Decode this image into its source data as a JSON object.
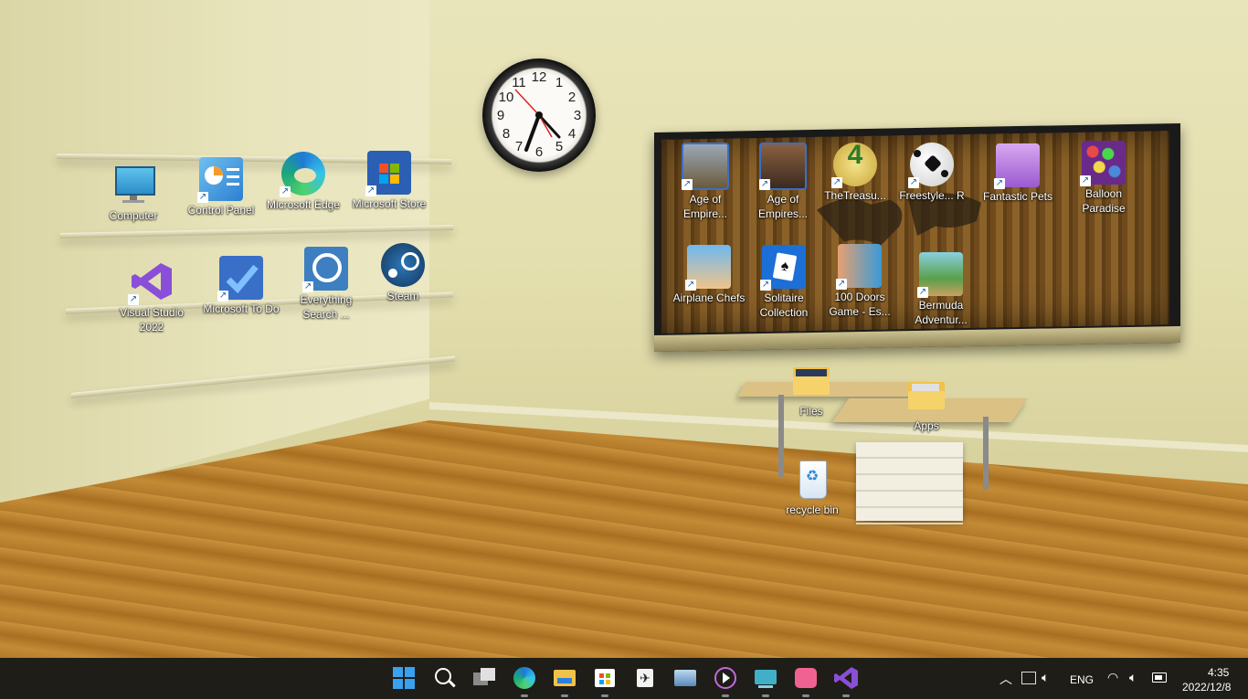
{
  "desktop": {
    "clock_numbers": [
      "12",
      "1",
      "2",
      "3",
      "4",
      "5",
      "6",
      "7",
      "8",
      "9",
      "10",
      "11"
    ],
    "icons": [
      {
        "label": "Computer",
        "icon": "monitor-icon",
        "color": "#3fa6d8",
        "shortcut": false
      },
      {
        "label": "Control Panel",
        "icon": "control-panel-icon",
        "color": "#4a9be0",
        "shortcut": true
      },
      {
        "label": "Microsoft Edge",
        "icon": "edge-icon",
        "color": "#1ba67b",
        "shortcut": true
      },
      {
        "label": "Microsoft Store",
        "icon": "store-icon",
        "color": "#2b5fb3",
        "shortcut": true
      },
      {
        "label": "Visual Studio 2022",
        "icon": "visual-studio-icon",
        "color": "#8a4fd8",
        "shortcut": true
      },
      {
        "label": "Microsoft To Do",
        "icon": "todo-icon",
        "color": "#2f6fd8",
        "shortcut": true
      },
      {
        "label": "Everything Search ...",
        "icon": "everything-search-icon",
        "color": "#3d7fc0",
        "shortcut": true
      },
      {
        "label": "Steam",
        "icon": "steam-icon",
        "color": "#16345a",
        "shortcut": false
      },
      {
        "label": "Age of Empire...",
        "icon": "age-of-empires-icon",
        "color": "#6b5a3a",
        "shortcut": true
      },
      {
        "label": "Age of Empires...",
        "icon": "age-of-empires-2-icon",
        "color": "#5a4030",
        "shortcut": true
      },
      {
        "label": "TheTreasu...",
        "icon": "treasure-icon",
        "color": "#c9a53a",
        "shortcut": true
      },
      {
        "label": "Freestyle... R",
        "icon": "soccer-ball-icon",
        "color": "#f2f2f2",
        "shortcut": true
      },
      {
        "label": "Fantastic Pets",
        "icon": "pet-icon",
        "color": "#b97ad8",
        "shortcut": true
      },
      {
        "label": "Balloon Paradise",
        "icon": "balloon-icon",
        "color": "#d84a4a",
        "shortcut": true
      },
      {
        "label": "Airplane Chefs",
        "icon": "chef-icon",
        "color": "#3f8fd8",
        "shortcut": true
      },
      {
        "label": "Solitaire Collection",
        "icon": "solitaire-icon",
        "color": "#1b6fd6",
        "shortcut": true
      },
      {
        "label": "100 Doors Game - Es...",
        "icon": "doors-icon",
        "color": "#3a9ad8",
        "shortcut": true
      },
      {
        "label": "Bermuda Adventur...",
        "icon": "bermuda-icon",
        "color": "#5aa04a",
        "shortcut": true
      },
      {
        "label": "Files",
        "icon": "folder-icon",
        "color": "#f1c24a",
        "shortcut": false
      },
      {
        "label": "Apps",
        "icon": "folder-icon",
        "color": "#f1c24a",
        "shortcut": false
      },
      {
        "label": "recycle bin",
        "icon": "recycle-bin-icon",
        "color": "#ffffff",
        "shortcut": false
      }
    ]
  },
  "taskbar": {
    "apps": [
      {
        "name": "start-icon",
        "color": "#3aa0f0"
      },
      {
        "name": "search-icon",
        "color": "#ffffff"
      },
      {
        "name": "task-view-icon",
        "color": "#bfbfbf"
      },
      {
        "name": "edge-icon",
        "color": "#1ba67b"
      },
      {
        "name": "file-explorer-icon",
        "color": "#f1c24a"
      },
      {
        "name": "store-icon",
        "color": "#2b7fe0"
      },
      {
        "name": "rocket-app-icon",
        "color": "#e8e8e8"
      },
      {
        "name": "photo-app-icon",
        "color": "#7fb3e0"
      },
      {
        "name": "media-player-icon",
        "color": "#c26adf"
      },
      {
        "name": "terminal-icon",
        "color": "#3fb0c8"
      },
      {
        "name": "bilibili-icon",
        "color": "#f06292"
      },
      {
        "name": "visual-studio-icon",
        "color": "#8a4fd8"
      }
    ],
    "tray": {
      "language": "ENG",
      "time": "4:35",
      "date": "2022/12/8"
    }
  }
}
